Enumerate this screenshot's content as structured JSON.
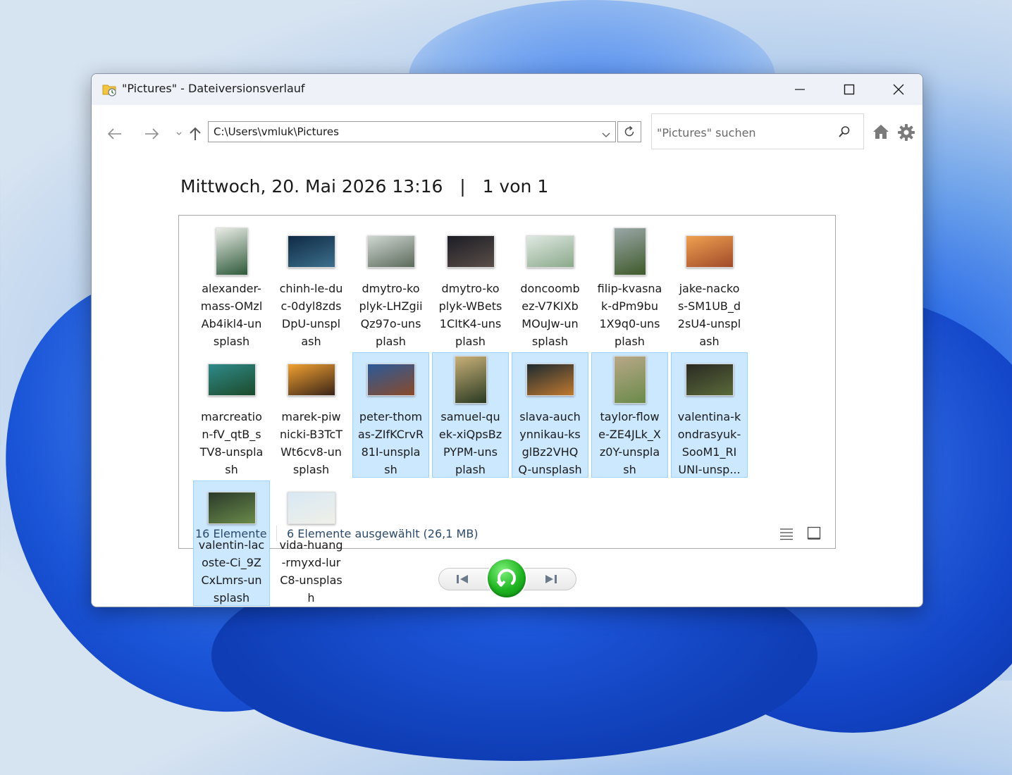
{
  "window": {
    "title": "\"Pictures\" - Dateiversionsverlauf"
  },
  "address_bar": {
    "path": "C:\\Users\\vmluk\\Pictures"
  },
  "search": {
    "placeholder": "\"Pictures\" suchen"
  },
  "heading": {
    "date": "Mittwoch, 20. Mai 2026 13:16",
    "separator": "|",
    "position": "1 von 1"
  },
  "files": [
    {
      "name": "alexander-\nmass-OMzl\nAb4ikl4-un\nsplash",
      "selected": false,
      "orientation": "portrait",
      "colors": [
        "#e9ece6",
        "#2f5a3a"
      ]
    },
    {
      "name": "chinh-le-du\nc-0dyl8zds\nDpU-unspl\nash",
      "selected": false,
      "orientation": "landscape",
      "colors": [
        "#0f2a44",
        "#3c6f8c"
      ]
    },
    {
      "name": "dmytro-ko\nplyk-LHZgii\nQz97o-uns\nplash",
      "selected": false,
      "orientation": "landscape",
      "colors": [
        "#cfd6d2",
        "#5b6a5a"
      ]
    },
    {
      "name": "dmytro-ko\nplyk-WBets\n1CItK4-uns\nplash",
      "selected": false,
      "orientation": "landscape",
      "colors": [
        "#1c1d25",
        "#5a4e48"
      ]
    },
    {
      "name": "doncoomb\nez-V7KIXb\nMOuJw-un\nsplash",
      "selected": false,
      "orientation": "landscape",
      "colors": [
        "#dfe8e2",
        "#8aa98a"
      ]
    },
    {
      "name": "filip-kvasna\nk-dPm9bu\n1X9q0-uns\nplash",
      "selected": false,
      "orientation": "portrait",
      "colors": [
        "#9aa7a8",
        "#3f5a2a"
      ]
    },
    {
      "name": "jake-nacko\ns-SM1UB_d\n2sU4-unspl\nash",
      "selected": false,
      "orientation": "landscape",
      "colors": [
        "#f0a050",
        "#a04a2a"
      ]
    },
    {
      "name": "marcreatio\nn-fV_qtB_s\nTV8-unspla\nsh",
      "selected": false,
      "orientation": "landscape",
      "colors": [
        "#2f8a8a",
        "#1c4a2a"
      ]
    },
    {
      "name": "marek-piw\nnicki-B3TcT\nWt6cv8-un\nsplash",
      "selected": false,
      "orientation": "landscape",
      "colors": [
        "#f0a030",
        "#3a2418"
      ]
    },
    {
      "name": "peter-thom\nas-ZIfKCrvR\n81I-unspla\nsh",
      "selected": true,
      "orientation": "landscape",
      "colors": [
        "#2a5a9a",
        "#8a4a2a"
      ]
    },
    {
      "name": "samuel-qu\nek-xiQpsBz\nPYPM-uns\nplash",
      "selected": true,
      "orientation": "portrait",
      "colors": [
        "#c8b078",
        "#2a3a22"
      ]
    },
    {
      "name": "slava-auch\nynnikau-ks\nglBz2VHQ\nQ-unsplash",
      "selected": true,
      "orientation": "landscape",
      "colors": [
        "#1c2a30",
        "#c07830"
      ]
    },
    {
      "name": "taylor-flow\ne-ZE4JLk_X\nz0Y-unspla\nsh",
      "selected": true,
      "orientation": "portrait",
      "colors": [
        "#b8a888",
        "#6a8a4a"
      ]
    },
    {
      "name": "valentina-k\nondrasyuk-\nSooM1_RI\nUNI-unsp...",
      "selected": true,
      "orientation": "landscape",
      "colors": [
        "#2a2a22",
        "#5a6a3a"
      ]
    },
    {
      "name": "valentin-lac\noste-Ci_9Z\nCxLmrs-un\nsplash",
      "selected": true,
      "orientation": "landscape",
      "colors": [
        "#2a3a2a",
        "#6a8a4a"
      ]
    },
    {
      "name": "vida-huang\n-rmyxd-lur\nC8-unsplas\nh",
      "selected": false,
      "orientation": "landscape",
      "colors": [
        "#d8e8f4",
        "#f0f0e8"
      ]
    }
  ],
  "status": {
    "count": "16 Elemente",
    "selection": "6 Elemente ausgewählt (26,1 MB)"
  },
  "icons": {
    "app": "file-history-icon",
    "back": "arrow-left-icon",
    "forward": "arrow-right-icon",
    "recent": "chevron-down-icon",
    "up": "arrow-up-icon",
    "refresh": "refresh-icon",
    "search": "search-icon",
    "home": "home-icon",
    "settings": "gear-icon",
    "previous": "previous-version-icon",
    "restore": "restore-icon",
    "next": "next-version-icon"
  },
  "colors": {
    "selection_fill": "#cce8ff",
    "selection_border": "#99d1ff",
    "restore_green": "#1fb421",
    "status_text": "#2a4a6a"
  }
}
